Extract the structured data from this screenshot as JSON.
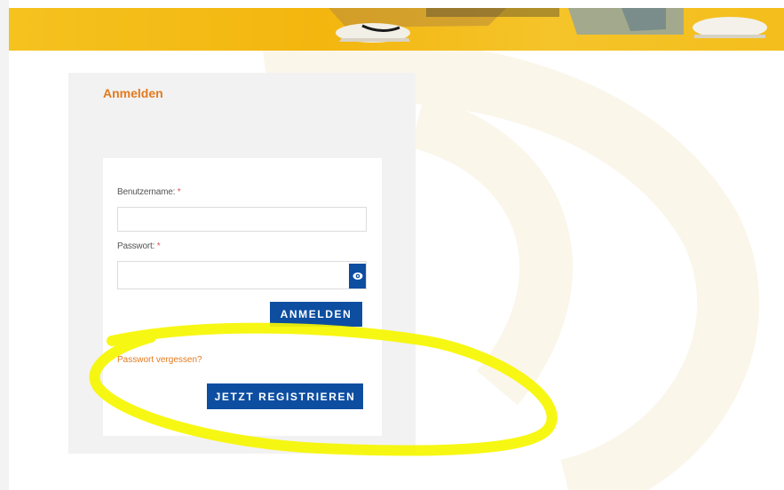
{
  "login": {
    "title": "Anmelden",
    "username_label": "Benutzername: ",
    "username_required": "*",
    "username_value": "",
    "password_label": "Passwort: ",
    "password_required": "*",
    "password_value": "",
    "toggle_icon": "eye-icon",
    "submit_label": "ANMELDEN",
    "forgot_link": "Passwort vergessen?",
    "register_label": "JETZT REGISTRIEREN"
  },
  "colors": {
    "brand_orange": "#e37a1e",
    "button_blue": "#0d4ea1",
    "banner_yellow": "#f5c21f",
    "highlight_yellow": "#f6f600"
  }
}
